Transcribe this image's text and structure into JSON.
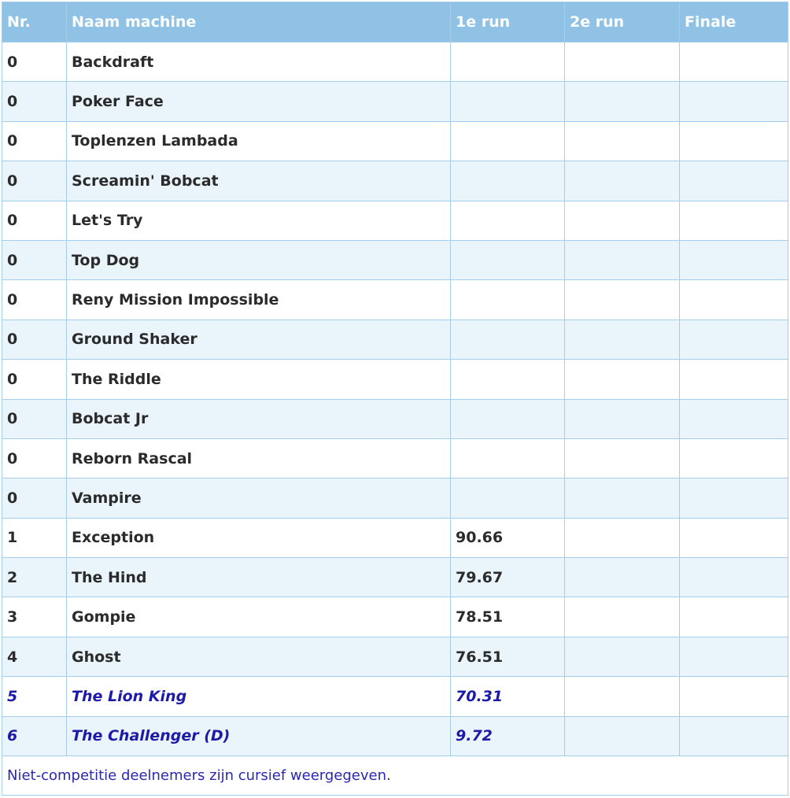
{
  "table": {
    "headers": {
      "nr": "Nr.",
      "name": "Naam machine",
      "run1": "1e run",
      "run2": "2e run",
      "final": "Finale"
    },
    "rows": [
      {
        "nr": "0",
        "name": "Backdraft",
        "run1": "",
        "run2": "",
        "final": "",
        "noncompetitive": false
      },
      {
        "nr": "0",
        "name": "Poker Face",
        "run1": "",
        "run2": "",
        "final": "",
        "noncompetitive": false
      },
      {
        "nr": "0",
        "name": "Toplenzen Lambada",
        "run1": "",
        "run2": "",
        "final": "",
        "noncompetitive": false
      },
      {
        "nr": "0",
        "name": "Screamin' Bobcat",
        "run1": "",
        "run2": "",
        "final": "",
        "noncompetitive": false
      },
      {
        "nr": "0",
        "name": "Let's Try",
        "run1": "",
        "run2": "",
        "final": "",
        "noncompetitive": false
      },
      {
        "nr": "0",
        "name": "Top Dog",
        "run1": "",
        "run2": "",
        "final": "",
        "noncompetitive": false
      },
      {
        "nr": "0",
        "name": "Reny Mission Impossible",
        "run1": "",
        "run2": "",
        "final": "",
        "noncompetitive": false
      },
      {
        "nr": "0",
        "name": "Ground Shaker",
        "run1": "",
        "run2": "",
        "final": "",
        "noncompetitive": false
      },
      {
        "nr": "0",
        "name": "The Riddle",
        "run1": "",
        "run2": "",
        "final": "",
        "noncompetitive": false
      },
      {
        "nr": "0",
        "name": "Bobcat Jr",
        "run1": "",
        "run2": "",
        "final": "",
        "noncompetitive": false
      },
      {
        "nr": "0",
        "name": "Reborn Rascal",
        "run1": "",
        "run2": "",
        "final": "",
        "noncompetitive": false
      },
      {
        "nr": "0",
        "name": "Vampire",
        "run1": "",
        "run2": "",
        "final": "",
        "noncompetitive": false
      },
      {
        "nr": "1",
        "name": "Exception",
        "run1": "90.66",
        "run2": "",
        "final": "",
        "noncompetitive": false
      },
      {
        "nr": "2",
        "name": "The Hind",
        "run1": "79.67",
        "run2": "",
        "final": "",
        "noncompetitive": false
      },
      {
        "nr": "3",
        "name": "Gompie",
        "run1": "78.51",
        "run2": "",
        "final": "",
        "noncompetitive": false
      },
      {
        "nr": "4",
        "name": "Ghost",
        "run1": "76.51",
        "run2": "",
        "final": "",
        "noncompetitive": false
      },
      {
        "nr": "5",
        "name": "The Lion King",
        "run1": "70.31",
        "run2": "",
        "final": "",
        "noncompetitive": true
      },
      {
        "nr": "6",
        "name": "The Challenger (D)",
        "run1": "9.72",
        "run2": "",
        "final": "",
        "noncompetitive": true
      }
    ],
    "footnote": "Niet-competitie deelnemers zijn cursief weergegeven."
  },
  "colors": {
    "header_bg": "#8fc2e5",
    "header_text": "#ffffff",
    "row_alt_bg": "#e9f5fb",
    "border": "#a6cde9",
    "noncompetitive_text": "#1d1aa8"
  }
}
